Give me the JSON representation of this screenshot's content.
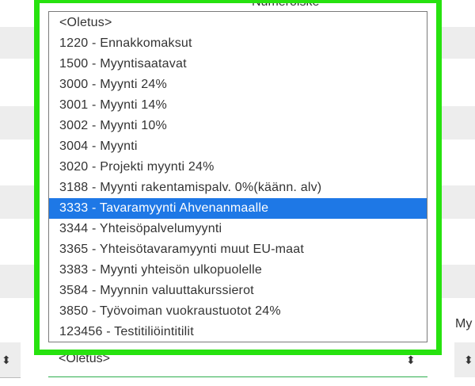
{
  "background": {
    "behind_label": "Numeroiske",
    "right_label": "My",
    "left_select_arrows": "⬍",
    "right_select_arrows": "⬍"
  },
  "select": {
    "current_value": "<Oletus>",
    "arrows": "⬍"
  },
  "dropdown": {
    "options": [
      {
        "label": "<Oletus>"
      },
      {
        "label": "1220 - Ennakkomaksut"
      },
      {
        "label": "1500 - Myyntisaatavat"
      },
      {
        "label": "3000 - Myynti 24%"
      },
      {
        "label": "3001 - Myynti 14%"
      },
      {
        "label": "3002 - Myynti 10%"
      },
      {
        "label": "3004 - Myynti"
      },
      {
        "label": "3020 - Projekti myynti 24%"
      },
      {
        "label": "3188 - Myynti rakentamispalv. 0%(käänn. alv)"
      },
      {
        "label": "3333 - Tavaramyynti Ahvenanmaalle"
      },
      {
        "label": "3344 - Yhteisöpalvelumyynti"
      },
      {
        "label": "3365 - Yhteisötavaramyynti muut EU-maat"
      },
      {
        "label": "3383 - Myynti yhteisön ulkopuolelle"
      },
      {
        "label": "3584 - Myynnin valuuttakurssierot"
      },
      {
        "label": "3850 - Työvoiman vuokraustuotot 24%"
      },
      {
        "label": "123456 - Testitiliöintitilit"
      }
    ],
    "highlighted_index": 9
  },
  "colors": {
    "highlight_frame": "#27e20f",
    "selected_option_bg": "#1e78e6",
    "selected_option_text": "#ffffff",
    "field_underline": "#2eae4f"
  }
}
